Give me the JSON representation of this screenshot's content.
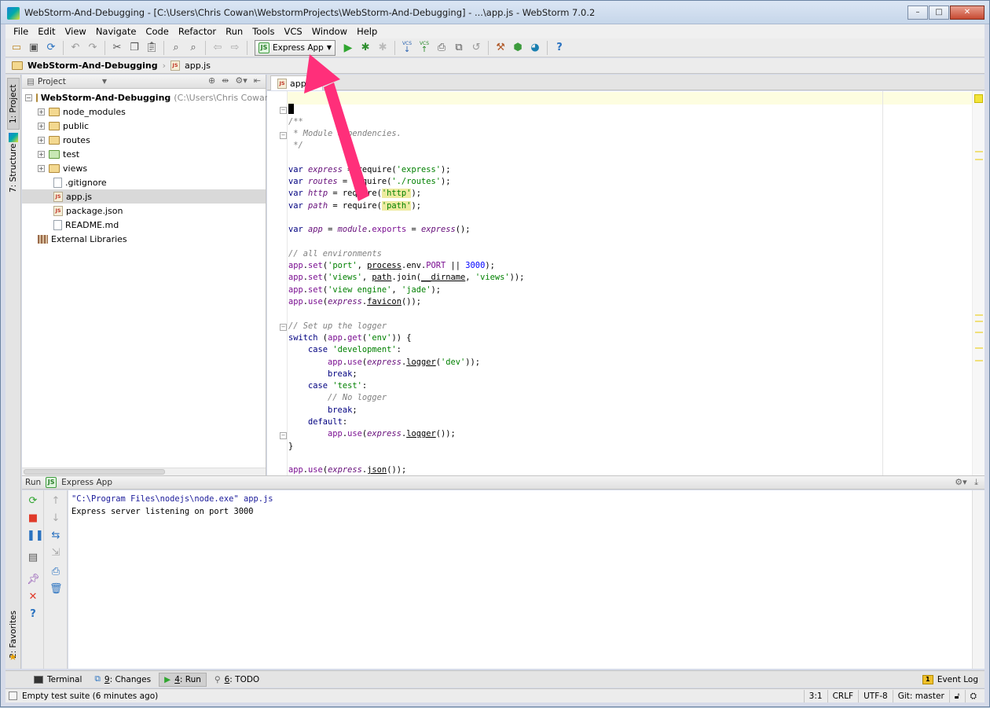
{
  "window": {
    "title": "WebStorm-And-Debugging - [C:\\Users\\Chris Cowan\\WebstormProjects\\WebStorm-And-Debugging] - ...\\app.js - WebStorm 7.0.2",
    "minimize": "–",
    "maximize": "□",
    "close": "✕"
  },
  "menu": [
    "File",
    "Edit",
    "View",
    "Navigate",
    "Code",
    "Refactor",
    "Run",
    "Tools",
    "VCS",
    "Window",
    "Help"
  ],
  "toolbar": {
    "run_config": "Express App",
    "js_badge": "JS",
    "vcs1": "VCS",
    "vcs2": "VCS",
    "help": "?"
  },
  "breadcrumb": {
    "project": "WebStorm-And-Debugging",
    "file": "app.js",
    "js_badge": "JS"
  },
  "left_tabs": {
    "project": "1: Project",
    "structure": "7: Structure",
    "favorites": "2: Favorites"
  },
  "project_panel": {
    "header": "Project",
    "root": "WebStorm-And-Debugging",
    "root_path": "(C:\\Users\\Chris Cowan\\Web",
    "items": [
      {
        "label": "node_modules",
        "type": "folder"
      },
      {
        "label": "public",
        "type": "folder"
      },
      {
        "label": "routes",
        "type": "folder"
      },
      {
        "label": "test",
        "type": "folder"
      },
      {
        "label": "views",
        "type": "folder"
      },
      {
        "label": ".gitignore",
        "type": "text"
      },
      {
        "label": "app.js",
        "type": "js"
      },
      {
        "label": "package.json",
        "type": "js"
      },
      {
        "label": "README.md",
        "type": "text"
      }
    ],
    "external": "External Libraries"
  },
  "editor": {
    "tab": "app.js",
    "js_badge": "JS"
  },
  "run_panel": {
    "label": "Run",
    "config": "Express App",
    "js_badge": "JS",
    "console": [
      "\"C:\\Program Files\\nodejs\\node.exe\" app.js",
      "Express server listening on port 3000"
    ]
  },
  "bottom_tabs": [
    {
      "key": "",
      "label": "Terminal",
      "active": false
    },
    {
      "key": "9",
      "label": ": Changes",
      "active": false
    },
    {
      "key": "4",
      "label": ": Run",
      "active": true
    },
    {
      "key": "6",
      "label": ": TODO",
      "active": false
    }
  ],
  "event_log": {
    "badge": "1",
    "label": "Event Log"
  },
  "status": {
    "message": "Empty test suite (6 minutes ago)",
    "position": "3:1",
    "line_sep": "CRLF",
    "encoding": "UTF-8",
    "vcs": "Git: master"
  },
  "colors": {
    "annotation_arrow": "#ff2f7a",
    "keyword": "#000080",
    "string": "#008000",
    "comment": "#808080"
  }
}
